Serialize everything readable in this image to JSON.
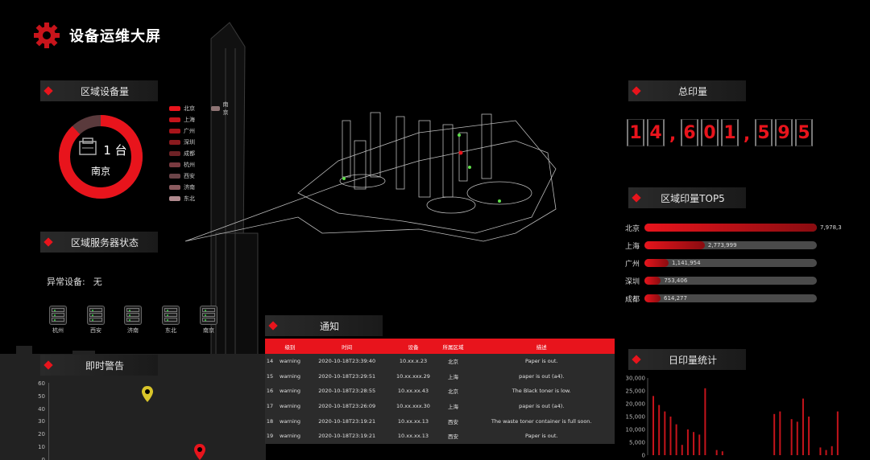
{
  "header": {
    "title": "设备运维大屏"
  },
  "panels": {
    "region_devices": "区域设备量",
    "server_status": "区域服务器状态",
    "instant_alerts": "即时警告",
    "notice": "通知",
    "total_prints": "总印量",
    "region_top5": "区域印量TOP5",
    "daily_prints": "日印量统计"
  },
  "donut": {
    "count": "1 台",
    "city": "南京",
    "fraction": 0.88
  },
  "legend": [
    {
      "name": "北京",
      "color": "#e8141c"
    },
    {
      "name": "南京",
      "color": "#8e7474"
    },
    {
      "name": "上海",
      "color": "#c4141b"
    },
    {
      "name": "广州",
      "color": "#a8141a"
    },
    {
      "name": "深圳",
      "color": "#8a1a1e"
    },
    {
      "name": "成都",
      "color": "#6e2226"
    },
    {
      "name": "杭州",
      "color": "#7a3a40"
    },
    {
      "name": "西安",
      "color": "#6c4448"
    },
    {
      "name": "济南",
      "color": "#8a5a5e"
    },
    {
      "name": "东北",
      "color": "#b08a8e"
    }
  ],
  "abnormal": {
    "label": "异常设备:",
    "value": "无"
  },
  "servers": [
    {
      "name": "杭州"
    },
    {
      "name": "西安"
    },
    {
      "name": "济南"
    },
    {
      "name": "东北"
    },
    {
      "name": "南京"
    }
  ],
  "warning_axis": [
    "60",
    "50",
    "40",
    "30",
    "20",
    "10",
    "0"
  ],
  "total": {
    "digits": [
      "1",
      "4",
      ",",
      "6",
      "0",
      "1",
      ",",
      "5",
      "9",
      "5"
    ]
  },
  "top5": [
    {
      "name": "北京",
      "value": "7,978,3",
      "fraction": 1.0
    },
    {
      "name": "上海",
      "value": "2,773,999",
      "fraction": 0.35
    },
    {
      "name": "广州",
      "value": "1,141,954",
      "fraction": 0.14
    },
    {
      "name": "深圳",
      "value": "753,406",
      "fraction": 0.095
    },
    {
      "name": "成都",
      "value": "614,277",
      "fraction": 0.077
    }
  ],
  "notice": {
    "columns": [
      "级别",
      "时间",
      "设备",
      "所属区域",
      "描述"
    ],
    "rows": [
      {
        "id": "14",
        "level": "warning",
        "time": "2020-10-18T23:39:40",
        "device": "10.xx.x.23",
        "region": "北京",
        "desc": "Paper is out."
      },
      {
        "id": "15",
        "level": "warning",
        "time": "2020-10-18T23:29:51",
        "device": "10.xx.xxx.29",
        "region": "上海",
        "desc": "paper is out (a4)."
      },
      {
        "id": "16",
        "level": "warning",
        "time": "2020-10-18T23:28:55",
        "device": "10.xx.xx.43",
        "region": "北京",
        "desc": "The Black toner is low."
      },
      {
        "id": "17",
        "level": "warning",
        "time": "2020-10-18T23:26:09",
        "device": "10.xx.xxx.30",
        "region": "上海",
        "desc": "paper is out (a4)."
      },
      {
        "id": "18",
        "level": "warning",
        "time": "2020-10-18T23:19:21",
        "device": "10.xx.xx.13",
        "region": "西安",
        "desc": "The waste toner container is full soon."
      },
      {
        "id": "19",
        "level": "warning",
        "time": "2020-10-18T23:19:21",
        "device": "10.xx.xx.13",
        "region": "西安",
        "desc": "Paper is out."
      }
    ]
  },
  "chart_data": {
    "type": "bar",
    "yticks": [
      "30,000",
      "25,000",
      "20,000",
      "15,000",
      "10,000",
      "5,000",
      "0"
    ],
    "ylim": [
      0,
      30000
    ],
    "values": [
      23000,
      19500,
      17000,
      15000,
      12000,
      4000,
      10000,
      9000,
      8000,
      26000,
      0,
      2000,
      1500,
      0,
      0,
      0,
      0,
      0,
      0,
      0,
      0,
      16000,
      17000,
      0,
      14000,
      13000,
      22000,
      15000,
      0,
      3000,
      2000,
      3500,
      17000
    ],
    "color": "#c4141b"
  }
}
